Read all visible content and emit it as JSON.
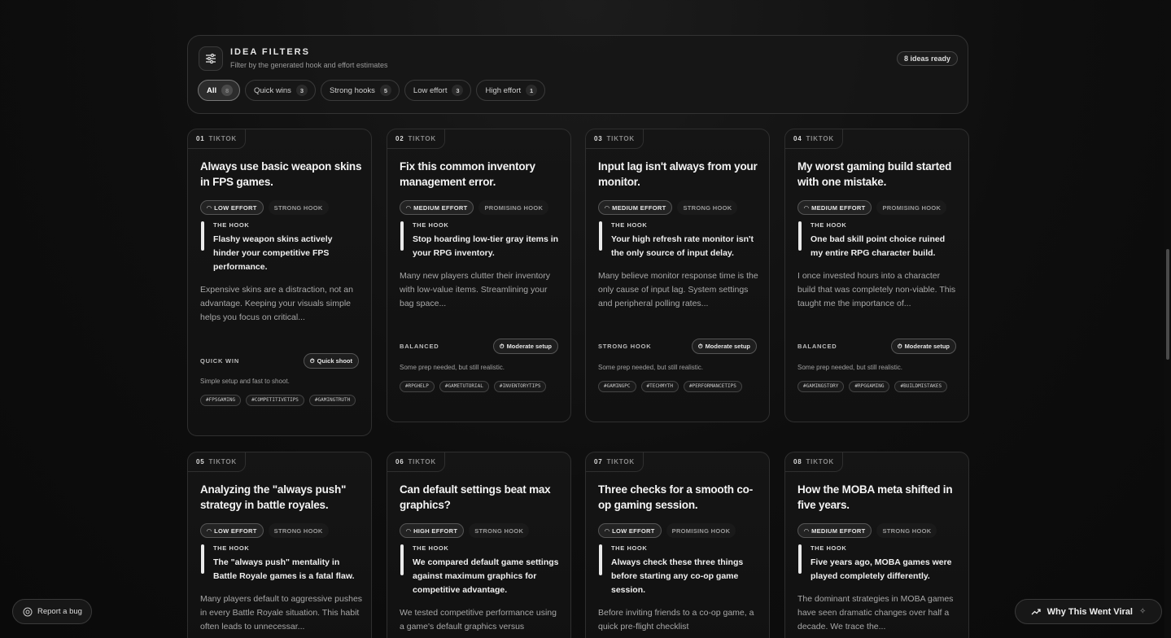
{
  "filters": {
    "title": "IDEA FILTERS",
    "subtitle": "Filter by the generated hook and effort estimates",
    "ready_badge": "8 ideas ready",
    "chips": [
      {
        "label": "All",
        "count": "8",
        "active": true
      },
      {
        "label": "Quick wins",
        "count": "3",
        "active": false
      },
      {
        "label": "Strong hooks",
        "count": "5",
        "active": false
      },
      {
        "label": "Low effort",
        "count": "3",
        "active": false
      },
      {
        "label": "High effort",
        "count": "1",
        "active": false
      }
    ]
  },
  "hook_label": "THE HOOK",
  "cards": [
    {
      "num": "01",
      "platform": "TIKTOK",
      "title": "Always use basic weapon skins in FPS games.",
      "effort": "LOW EFFORT",
      "hook_strength": "STRONG HOOK",
      "hook": "Flashy weapon skins actively hinder your competitive FPS performance.",
      "desc": "Expensive skins are a distraction, not an advantage. Keeping your visuals simple helps you focus on critical...",
      "foot_label": "QUICK WIN",
      "setup": "Quick shoot",
      "foot_note": "Simple setup and fast to shoot.",
      "tags": [
        "#FPSGAMING",
        "#COMPETITIVETIPS",
        "#GAMINGTRUTH"
      ]
    },
    {
      "num": "02",
      "platform": "TIKTOK",
      "title": "Fix this common inventory management error.",
      "effort": "MEDIUM EFFORT",
      "hook_strength": "PROMISING HOOK",
      "hook": "Stop hoarding low-tier gray items in your RPG inventory.",
      "desc": "Many new players clutter their inventory with low-value items. Streamlining your bag space...",
      "foot_label": "BALANCED",
      "setup": "Moderate setup",
      "foot_note": "Some prep needed, but still realistic.",
      "tags": [
        "#RPGHELP",
        "#GAMETUTORIAL",
        "#INVENTORYTIPS"
      ]
    },
    {
      "num": "03",
      "platform": "TIKTOK",
      "title": "Input lag isn't always from your monitor.",
      "effort": "MEDIUM EFFORT",
      "hook_strength": "STRONG HOOK",
      "hook": "Your high refresh rate monitor isn't the only source of input delay.",
      "desc": "Many believe monitor response time is the only cause of input lag. System settings and peripheral polling rates...",
      "foot_label": "STRONG HOOK",
      "setup": "Moderate setup",
      "foot_note": "Some prep needed, but still realistic.",
      "tags": [
        "#GAMINGPC",
        "#TECHMYTH",
        "#PERFORMANCETIPS"
      ]
    },
    {
      "num": "04",
      "platform": "TIKTOK",
      "title": "My worst gaming build started with one mistake.",
      "effort": "MEDIUM EFFORT",
      "hook_strength": "PROMISING HOOK",
      "hook": "One bad skill point choice ruined my entire RPG character build.",
      "desc": "I once invested hours into a character build that was completely non-viable. This taught me the importance of...",
      "foot_label": "BALANCED",
      "setup": "Moderate setup",
      "foot_note": "Some prep needed, but still realistic.",
      "tags": [
        "#GAMINGSTORY",
        "#RPGGAMING",
        "#BUILDMISTAKES"
      ]
    },
    {
      "num": "05",
      "platform": "TIKTOK",
      "title": "Analyzing the \"always push\" strategy in battle royales.",
      "effort": "LOW EFFORT",
      "hook_strength": "STRONG HOOK",
      "hook": "The \"always push\" mentality in Battle Royale games is a fatal flaw.",
      "desc": "Many players default to aggressive pushes in every Battle Royale situation. This habit often leads to unnecessar...",
      "foot_label": "",
      "setup": "",
      "foot_note": "",
      "tags": []
    },
    {
      "num": "06",
      "platform": "TIKTOK",
      "title": "Can default settings beat max graphics?",
      "effort": "HIGH EFFORT",
      "hook_strength": "STRONG HOOK",
      "hook": "We compared default game settings against maximum graphics for competitive advantage.",
      "desc": "We tested competitive performance using a game's default graphics versus",
      "foot_label": "",
      "setup": "",
      "foot_note": "",
      "tags": []
    },
    {
      "num": "07",
      "platform": "TIKTOK",
      "title": "Three checks for a smooth co-op gaming session.",
      "effort": "LOW EFFORT",
      "hook_strength": "PROMISING HOOK",
      "hook": "Always check these three things before starting any co-op game session.",
      "desc": "Before inviting friends to a co-op game, a quick pre-flight checklist",
      "foot_label": "",
      "setup": "",
      "foot_note": "",
      "tags": []
    },
    {
      "num": "08",
      "platform": "TIKTOK",
      "title": "How the MOBA meta shifted in five years.",
      "effort": "MEDIUM EFFORT",
      "hook_strength": "STRONG HOOK",
      "hook": "Five years ago, MOBA games were played completely differently.",
      "desc": "The dominant strategies in MOBA games have seen dramatic changes over half a decade. We trace the...",
      "foot_label": "",
      "setup": "",
      "foot_note": "",
      "tags": []
    }
  ],
  "bug_button": "Report a bug",
  "viral_button": "Why This Went Viral"
}
